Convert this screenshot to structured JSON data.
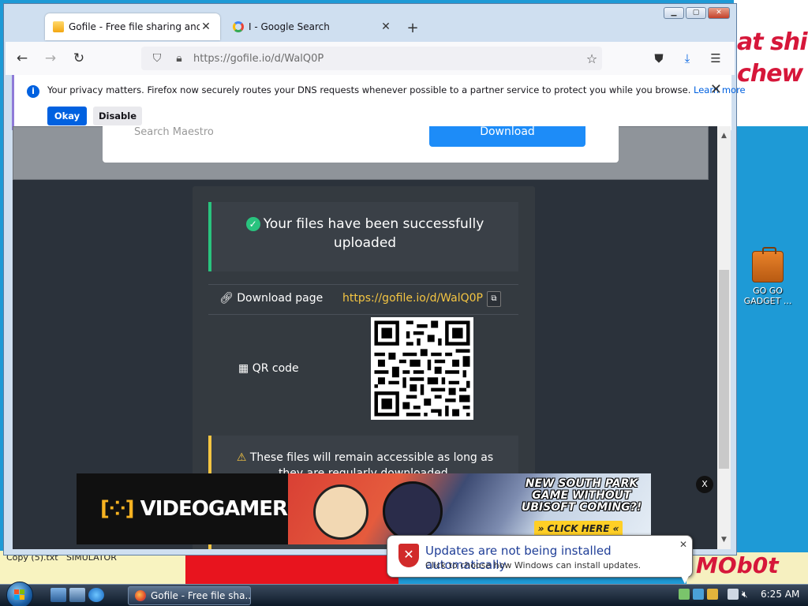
{
  "desktop": {
    "wall_text": "at shit\nchew",
    "icon_label": "GO GO\nGADGET ...",
    "bottom_labels": [
      "Copy (5).txt",
      "SIMULATOR"
    ],
    "mobot_text": "MOb0t"
  },
  "browser": {
    "tabs": [
      {
        "title": "Gofile - Free file sharing and sto",
        "active": true,
        "icon": "folder-favicon"
      },
      {
        "title": "I - Google Search",
        "active": false,
        "icon": "google-favicon"
      }
    ],
    "url": "https://gofile.io/d/WalQ0P",
    "notice": {
      "message": "Your privacy matters. Firefox now securely routes your DNS requests whenever possible to a partner service to protect you while you browse.",
      "learn_more": "Learn more",
      "okay": "Okay",
      "disable": "Disable"
    }
  },
  "page": {
    "search_placeholder": "Search Maestro",
    "download_button": "Download",
    "success_message": "Your files have been successfully uploaded",
    "download_page_label": "Download page",
    "download_link": "https://gofile.io/d/WalQ0P",
    "qr_label": "QR code",
    "warning_message": "These files will remain accessible as long as they are regularly downloaded."
  },
  "ad": {
    "brand": "VIDEOGAMER",
    "headline": "NEW SOUTH PARK GAME WITHOUT UBISOFT COMING?!",
    "cta": "» CLICK HERE «",
    "close": "X"
  },
  "balloon": {
    "title": "Updates are not being installed automatically",
    "subtitle": "Click to choose how Windows can install updates."
  },
  "taskbar": {
    "task_label": "Gofile - Free file sha...",
    "clock": "6:25 AM"
  },
  "colors": {
    "accent_blue": "#0061e0",
    "success_green": "#29c37e",
    "link_yellow": "#f4c542",
    "page_bg": "#2b323b"
  }
}
